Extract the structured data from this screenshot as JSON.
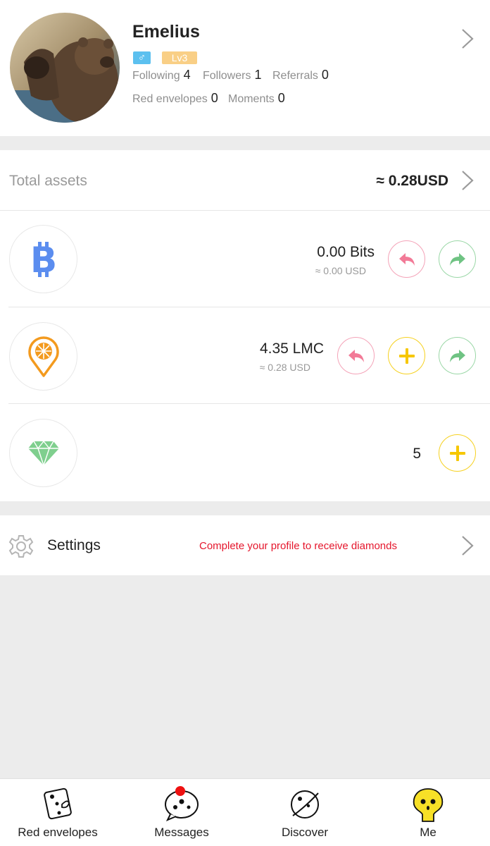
{
  "profile": {
    "name": "Emelius",
    "gender_symbol": "♂",
    "level": "Lv3",
    "following_label": "Following",
    "following_count": "4",
    "followers_label": "Followers",
    "followers_count": "1",
    "referrals_label": "Referrals",
    "referrals_count": "0",
    "red_envelopes_label": "Red envelopes",
    "red_envelopes_count": "0",
    "moments_label": "Moments",
    "moments_count": "0"
  },
  "assets": {
    "label": "Total assets",
    "total": "≈ 0.28USD"
  },
  "coins": [
    {
      "name": "Bits",
      "amount": "0.00 Bits",
      "usd": "≈ 0.00 USD",
      "icon": "bitcoin-icon"
    },
    {
      "name": "LMC",
      "amount": "4.35 LMC",
      "usd": "≈ 0.28 USD",
      "icon": "orange-pin-icon"
    },
    {
      "name": "Diamonds",
      "amount": "5",
      "icon": "diamond-icon"
    }
  ],
  "settings": {
    "label": "Settings",
    "hint": "Complete your profile to receive diamonds"
  },
  "tabs": [
    {
      "label": "Red envelopes",
      "icon": "dice-icon"
    },
    {
      "label": "Messages",
      "icon": "chat-bubble-icon",
      "badge": true
    },
    {
      "label": "Discover",
      "icon": "planet-icon"
    },
    {
      "label": "Me",
      "icon": "mascot-icon",
      "active": true
    }
  ],
  "colors": {
    "accent_yellow": "#f6d11f",
    "receive_red": "#f27a97",
    "send_green": "#6fc383",
    "hint_red": "#e5162c",
    "gender_blue": "#5cc0ef",
    "level_orange": "#f9cf86",
    "bitcoin_blue": "#5b8def",
    "diamond_green": "#7fcf8e"
  }
}
